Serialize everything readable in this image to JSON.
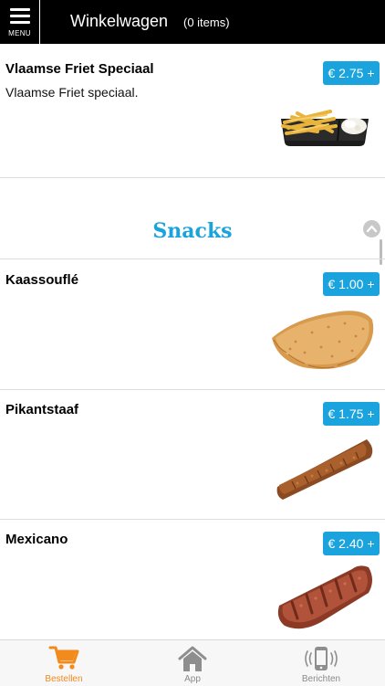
{
  "header": {
    "menu_label": "MENU",
    "title": "Winkelwagen",
    "item_count": "(0 items)"
  },
  "products_top": [
    {
      "name": "Vlaamse Friet Speciaal",
      "description": "Vlaamse Friet speciaal.",
      "price": "€ 2.75 +"
    }
  ],
  "section": {
    "title": "Snacks"
  },
  "products": [
    {
      "name": "Kaassouflé",
      "price": "€ 1.00 +"
    },
    {
      "name": "Pikantstaaf",
      "price": "€ 1.75 +"
    },
    {
      "name": "Mexicano",
      "price": "€ 2.40 +"
    }
  ],
  "tabs": [
    {
      "label": "Bestellen",
      "icon": "cart-icon",
      "active": true
    },
    {
      "label": "App",
      "icon": "home-icon",
      "active": false
    },
    {
      "label": "Berichten",
      "icon": "phone-icon",
      "active": false
    }
  ],
  "colors": {
    "accent": "#1aa3dc",
    "active_tab": "#f28a1c",
    "header_bg": "#000000"
  }
}
